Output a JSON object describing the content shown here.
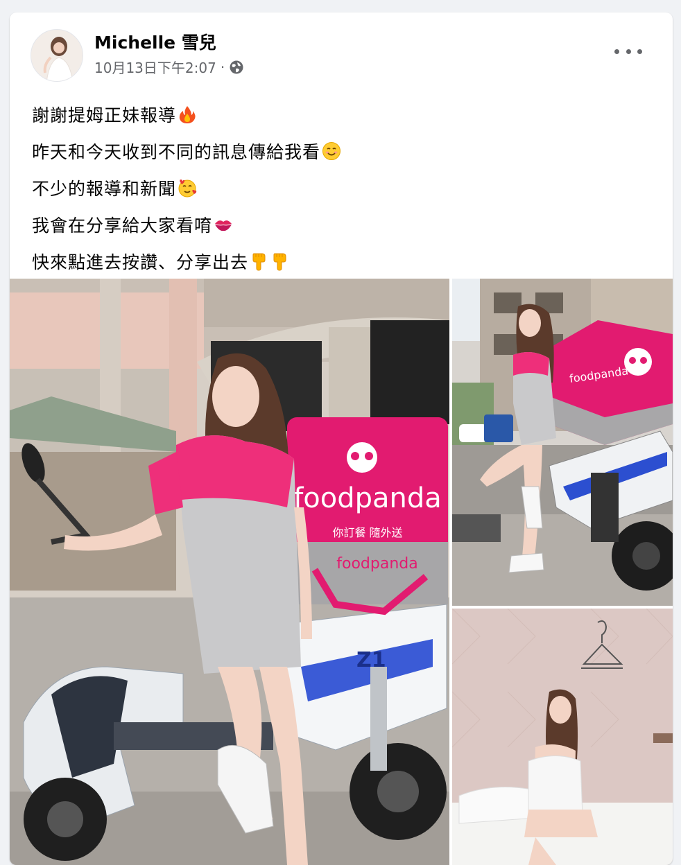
{
  "post": {
    "author": "Michelle 雪兒",
    "timestamp": "10月13日下午2:07",
    "separator": "·",
    "privacy_icon": "globe-icon",
    "more_icon": "more-dots-icon",
    "lines": [
      {
        "text": "謝謝提姆正妹報導",
        "emoji": "fire-emoji"
      },
      {
        "text": "昨天和今天收到不同的訊息傳給我看",
        "emoji": "smiling-face-emoji"
      },
      {
        "text": "不少的報導和新聞",
        "emoji": "smiling-face-with-hearts-emoji"
      },
      {
        "text": "我會在分享給大家看唷",
        "emoji": "kiss-mark-emoji"
      },
      {
        "text": "快來點進去按讚、分享出去",
        "emoji": "pointing-down-emoji"
      }
    ]
  },
  "photos": {
    "main": {
      "box_brand": "foodpanda",
      "box_slogan": "你訂餐 隨外送",
      "box_brand_small": "foodpanda",
      "scooter_model": "Z1"
    },
    "top_right": {
      "box_brand": "foodpanda"
    },
    "bottom_right": {}
  },
  "colors": {
    "brand_pink": "#e21b70",
    "text_secondary": "#65676b",
    "text_primary": "#050505"
  }
}
